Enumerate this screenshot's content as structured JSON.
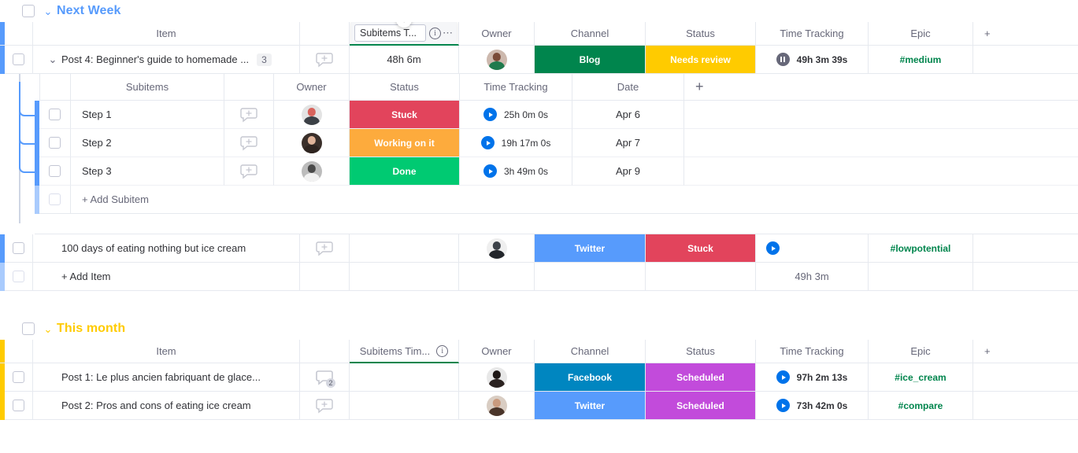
{
  "groups": [
    {
      "name": "Next Week",
      "color": "#579bfc",
      "columns": [
        "Item",
        "Subitems T...",
        "Owner",
        "Channel",
        "Status",
        "Time Tracking",
        "Epic"
      ],
      "add_column_label": "+",
      "header_edit": {
        "input_value": "Subitems T...",
        "info_icon": "info-icon",
        "menu_icon": "more-options-icon",
        "resize_icon": "resize-vertical-icon"
      },
      "items": [
        {
          "name": "Post 4: Beginner's guide to homemade ...",
          "subitem_count": "3",
          "chat_badge": "",
          "subitems_time": "48h 6m",
          "owner": "avatar-female-green",
          "channel": {
            "label": "Blog",
            "color": "#00854d"
          },
          "status": {
            "label": "Needs review",
            "color": "#fdab3d"
          },
          "time_tracking": {
            "value": "49h 3m 39s",
            "state": "paused"
          },
          "epic": "#medium"
        },
        {
          "name": "100 days of eating nothing but ice cream",
          "subitem_count": "",
          "subitems_time": "",
          "owner": "avatar-dark-suit",
          "channel": {
            "label": "Twitter",
            "color": "#579bfc"
          },
          "status": {
            "label": "Stuck",
            "color": "#e2445c"
          },
          "time_tracking": {
            "value": "",
            "state": "running"
          },
          "epic": "#lowpotential"
        }
      ],
      "add_item_label": "+ Add Item",
      "summary": {
        "time_tracking": "49h 3m"
      }
    },
    {
      "name": "This month",
      "color": "#ffcb00",
      "columns": [
        "Item",
        "Subitems Tim...",
        "Owner",
        "Channel",
        "Status",
        "Time Tracking",
        "Epic"
      ],
      "add_column_label": "+",
      "items": [
        {
          "name": "Post 1: Le plus ancien fabriquant de glace...",
          "chat_badge": "2",
          "subitems_time": "",
          "owner": "avatar-dark-hair",
          "channel": {
            "label": "Facebook",
            "color": "#0086c0"
          },
          "status": {
            "label": "Scheduled",
            "color": "#c24bdb"
          },
          "time_tracking": {
            "value": "97h 2m 13s",
            "state": "running"
          },
          "epic": "#ice_cream"
        },
        {
          "name": "Post 2: Pros and cons of eating ice cream",
          "chat_badge": "",
          "subitems_time": "",
          "owner": "avatar-brown-hair",
          "channel": {
            "label": "Twitter",
            "color": "#579bfc"
          },
          "status": {
            "label": "Scheduled",
            "color": "#c24bdb"
          },
          "time_tracking": {
            "value": "73h 42m 0s",
            "state": "running"
          },
          "epic": "#compare"
        }
      ]
    }
  ],
  "subitems_board": {
    "columns": [
      "Subitems",
      "Owner",
      "Status",
      "Time Tracking",
      "Date"
    ],
    "add_column_label": "+",
    "rows": [
      {
        "name": "Step 1",
        "owner": "avatar-red-cap",
        "status": {
          "label": "Stuck",
          "color": "#e2445c"
        },
        "time_tracking": {
          "value": "25h 0m 0s",
          "state": "running"
        },
        "date": "Apr 6"
      },
      {
        "name": "Step 2",
        "owner": "avatar-blonde",
        "status": {
          "label": "Working on it",
          "color": "#fdab3d"
        },
        "time_tracking": {
          "value": "19h 17m 0s",
          "state": "running"
        },
        "date": "Apr 7"
      },
      {
        "name": "Step 3",
        "owner": "avatar-gray",
        "status": {
          "label": "Done",
          "color": "#00ca72"
        },
        "time_tracking": {
          "value": "3h 49m 0s",
          "state": "running"
        },
        "date": "Apr 9"
      }
    ],
    "add_subitem_label": "+ Add Subitem"
  }
}
